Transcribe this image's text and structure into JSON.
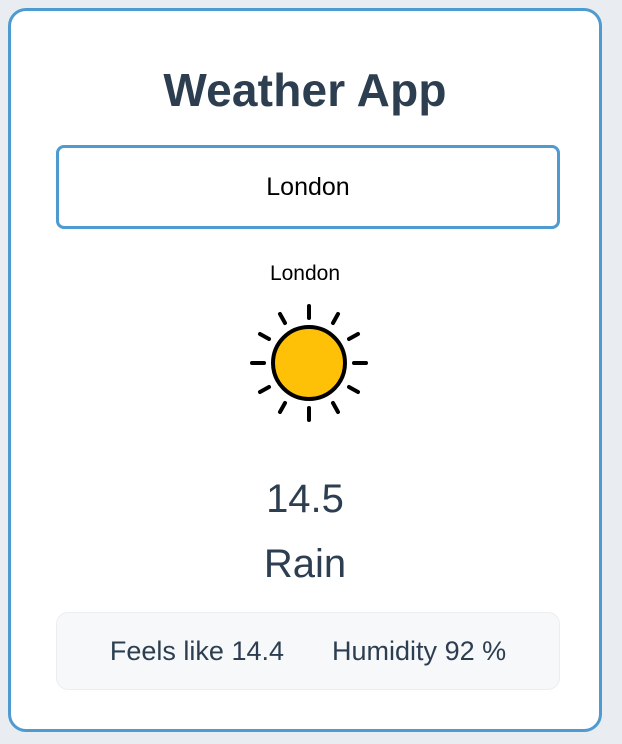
{
  "app": {
    "title": "Weather App"
  },
  "search": {
    "value": "London"
  },
  "weather": {
    "location": "London",
    "icon": "sun-icon",
    "temperature": "14.5",
    "condition": "Rain",
    "feels_like_label": "Feels like",
    "feels_like_value": "14.4",
    "humidity_label": "Humidity",
    "humidity_value": "92 %"
  },
  "colors": {
    "accent": "#4d9bd0",
    "text": "#2c3e50",
    "sun_fill": "#ffc107"
  }
}
